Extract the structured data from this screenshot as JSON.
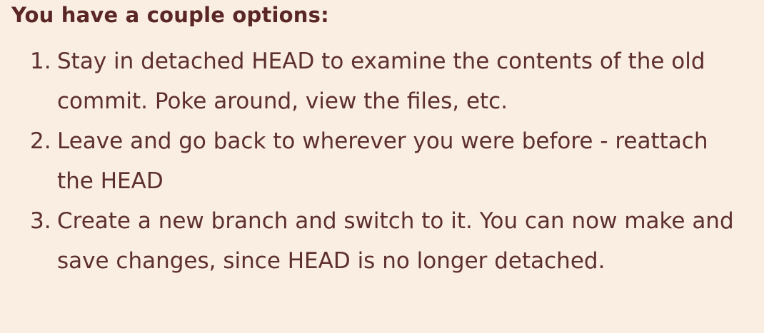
{
  "heading": "You have a couple options:",
  "options": [
    {
      "number": "1.",
      "text": "Stay in detached HEAD to examine the contents of the old commit.  Poke around, view the files, etc."
    },
    {
      "number": "2.",
      "text": "Leave and go back to wherever you were before - reattach the HEAD"
    },
    {
      "number": "3.",
      "text": "Create a new branch and switch to it.  You can now make and save changes, since HEAD is no longer detached."
    }
  ]
}
